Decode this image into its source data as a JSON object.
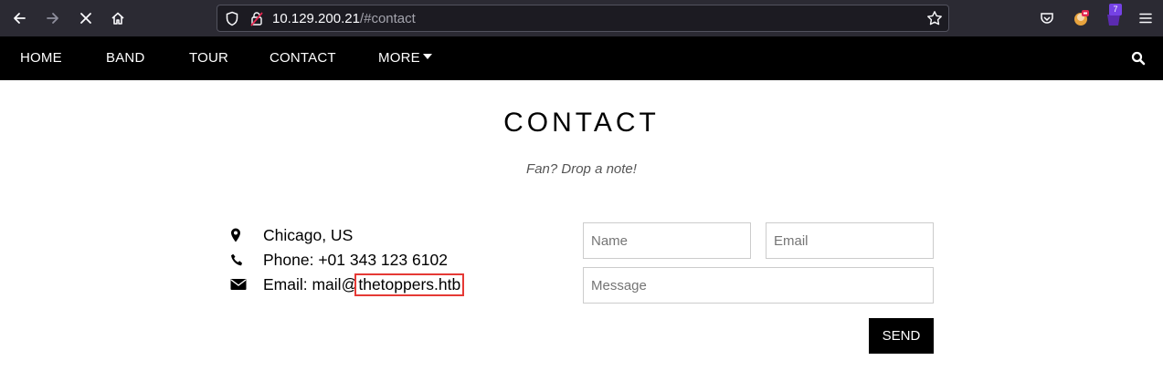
{
  "browser": {
    "url_host": "10.129.200.21",
    "url_hash": "/#contact",
    "extension_badge": "7",
    "icons": [
      "back-arrow-icon",
      "forward-arrow-icon",
      "stop-icon",
      "home-icon",
      "shield-icon",
      "lock-icon",
      "bookmark-star-icon",
      "pocket-icon",
      "extension-icon",
      "extension-icon",
      "menu-icon"
    ]
  },
  "nav": {
    "items": [
      "HOME",
      "BAND",
      "TOUR",
      "CONTACT"
    ],
    "more_label": "MORE"
  },
  "contact": {
    "title": "CONTACT",
    "subtitle": "Fan? Drop a note!",
    "location": "Chicago, US",
    "phone": "Phone: +01 343 123 6102",
    "email_prefix": "Email: mail@",
    "email_domain": "thetoppers.htb",
    "highlight_color": "#e53935"
  },
  "form": {
    "name_placeholder": "Name",
    "email_placeholder": "Email",
    "message_placeholder": "Message",
    "send_label": "SEND"
  }
}
